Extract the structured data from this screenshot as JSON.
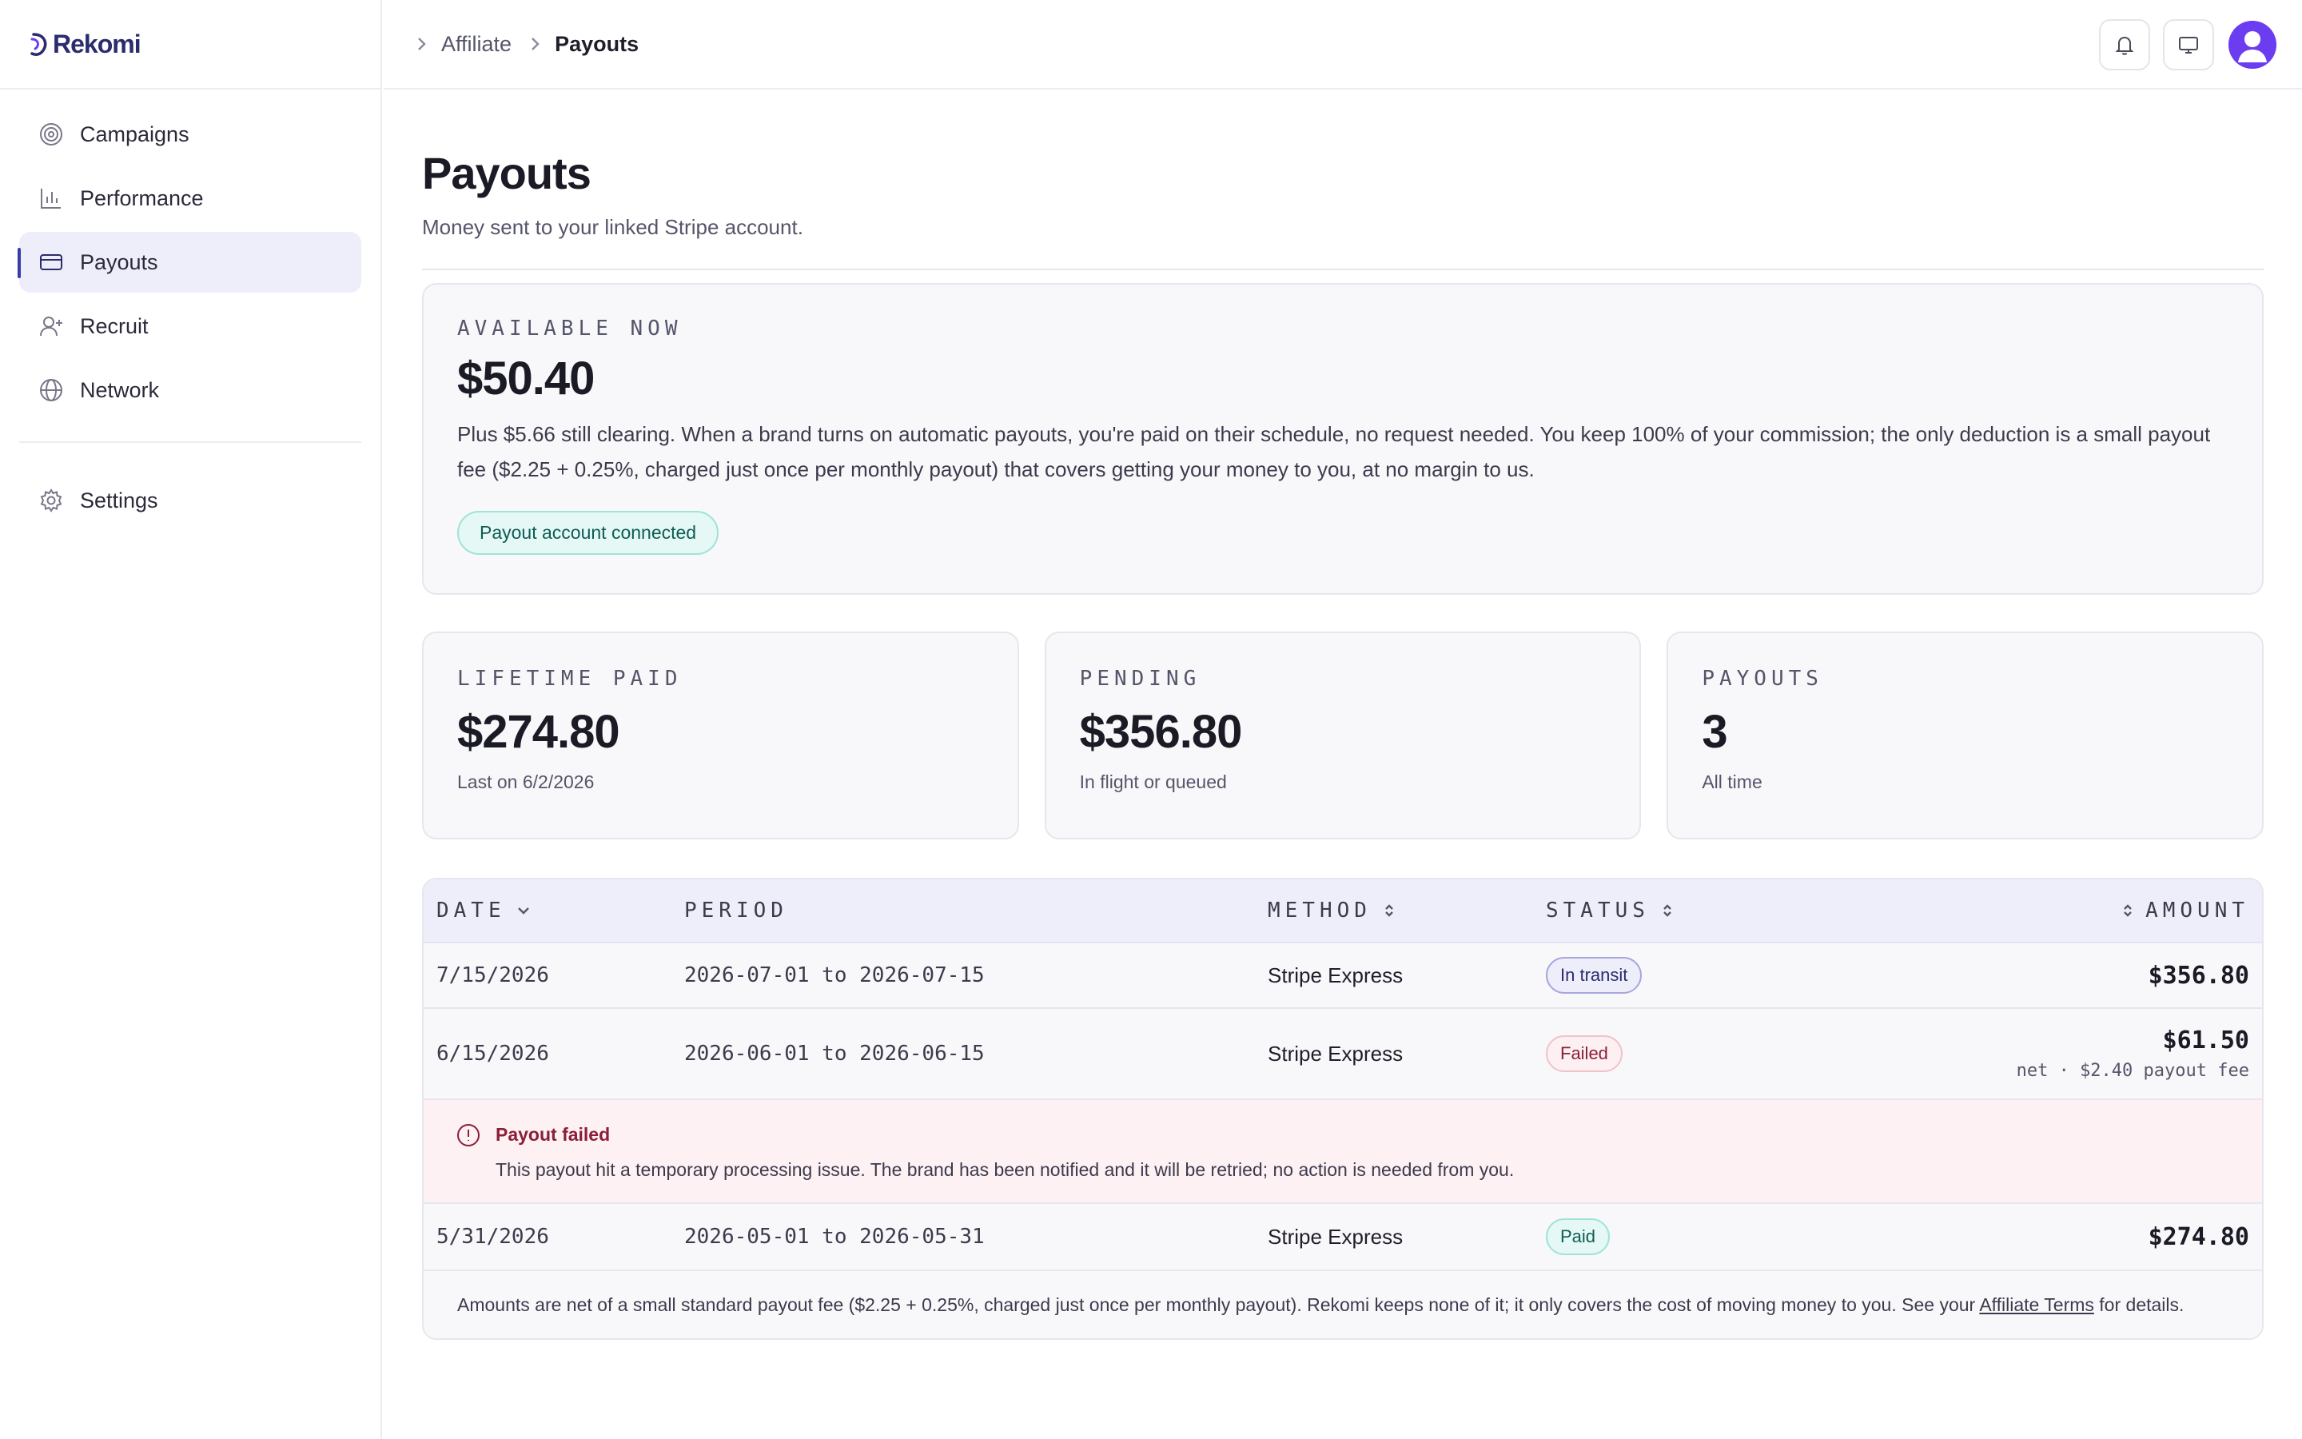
{
  "app": {
    "name": "Rekomi"
  },
  "sidebar": {
    "items": [
      {
        "label": "Campaigns",
        "icon": "target-icon"
      },
      {
        "label": "Performance",
        "icon": "bar-chart-icon"
      },
      {
        "label": "Payouts",
        "icon": "credit-card-icon",
        "active": true
      },
      {
        "label": "Recruit",
        "icon": "user-plus-icon"
      },
      {
        "label": "Network",
        "icon": "globe-icon"
      }
    ],
    "settings": {
      "label": "Settings",
      "icon": "gear-icon"
    }
  },
  "breadcrumb": {
    "parent": "Affiliate",
    "current": "Payouts"
  },
  "page": {
    "title": "Payouts",
    "subtitle": "Money sent to your linked Stripe account."
  },
  "available": {
    "label": "AVAILABLE NOW",
    "amount": "$50.40",
    "description": "Plus $5.66 still clearing. When a brand turns on automatic payouts, you're paid on their schedule, no request needed. You keep 100% of your commission; the only deduction is a small payout fee ($2.25 + 0.25%, charged just once per monthly payout) that covers getting your money to you, at no margin to us.",
    "badge": "Payout account connected"
  },
  "stats": [
    {
      "label": "LIFETIME PAID",
      "value": "$274.80",
      "sub": "Last on 6/2/2026"
    },
    {
      "label": "PENDING",
      "value": "$356.80",
      "sub": "In flight or queued"
    },
    {
      "label": "PAYOUTS",
      "value": "3",
      "sub": "All time"
    }
  ],
  "table": {
    "headers": {
      "date": "DATE",
      "period": "PERIOD",
      "method": "METHOD",
      "status": "STATUS",
      "amount": "AMOUNT"
    },
    "rows": [
      {
        "date": "7/15/2026",
        "period": "2026-07-01 to 2026-07-15",
        "method": "Stripe Express",
        "status": "In transit",
        "amount": "$356.80"
      },
      {
        "date": "6/15/2026",
        "period": "2026-06-01 to 2026-06-15",
        "method": "Stripe Express",
        "status": "Failed",
        "amount": "$61.50",
        "note": "net · $2.40 payout fee"
      },
      {
        "date": "5/31/2026",
        "period": "2026-05-01 to 2026-05-31",
        "method": "Stripe Express",
        "status": "Paid",
        "amount": "$274.80"
      }
    ],
    "failure": {
      "title": "Payout failed",
      "message": "This payout hit a temporary processing issue. The brand has been notified and it will be retried; no action is needed from you."
    },
    "footer": {
      "text_before": "Amounts are net of a small standard payout fee ($2.25 + 0.25%, charged just once per monthly payout). Rekomi keeps none of it; it only covers the cost of moving money to you. See your ",
      "link": "Affiliate Terms",
      "text_after": " for details."
    }
  },
  "colors": {
    "brand": "#2a2c6e",
    "accent": "#6c3df0",
    "paid": "#0d5d55",
    "failed": "#8a1f36",
    "transit": "#2a2c6e"
  }
}
